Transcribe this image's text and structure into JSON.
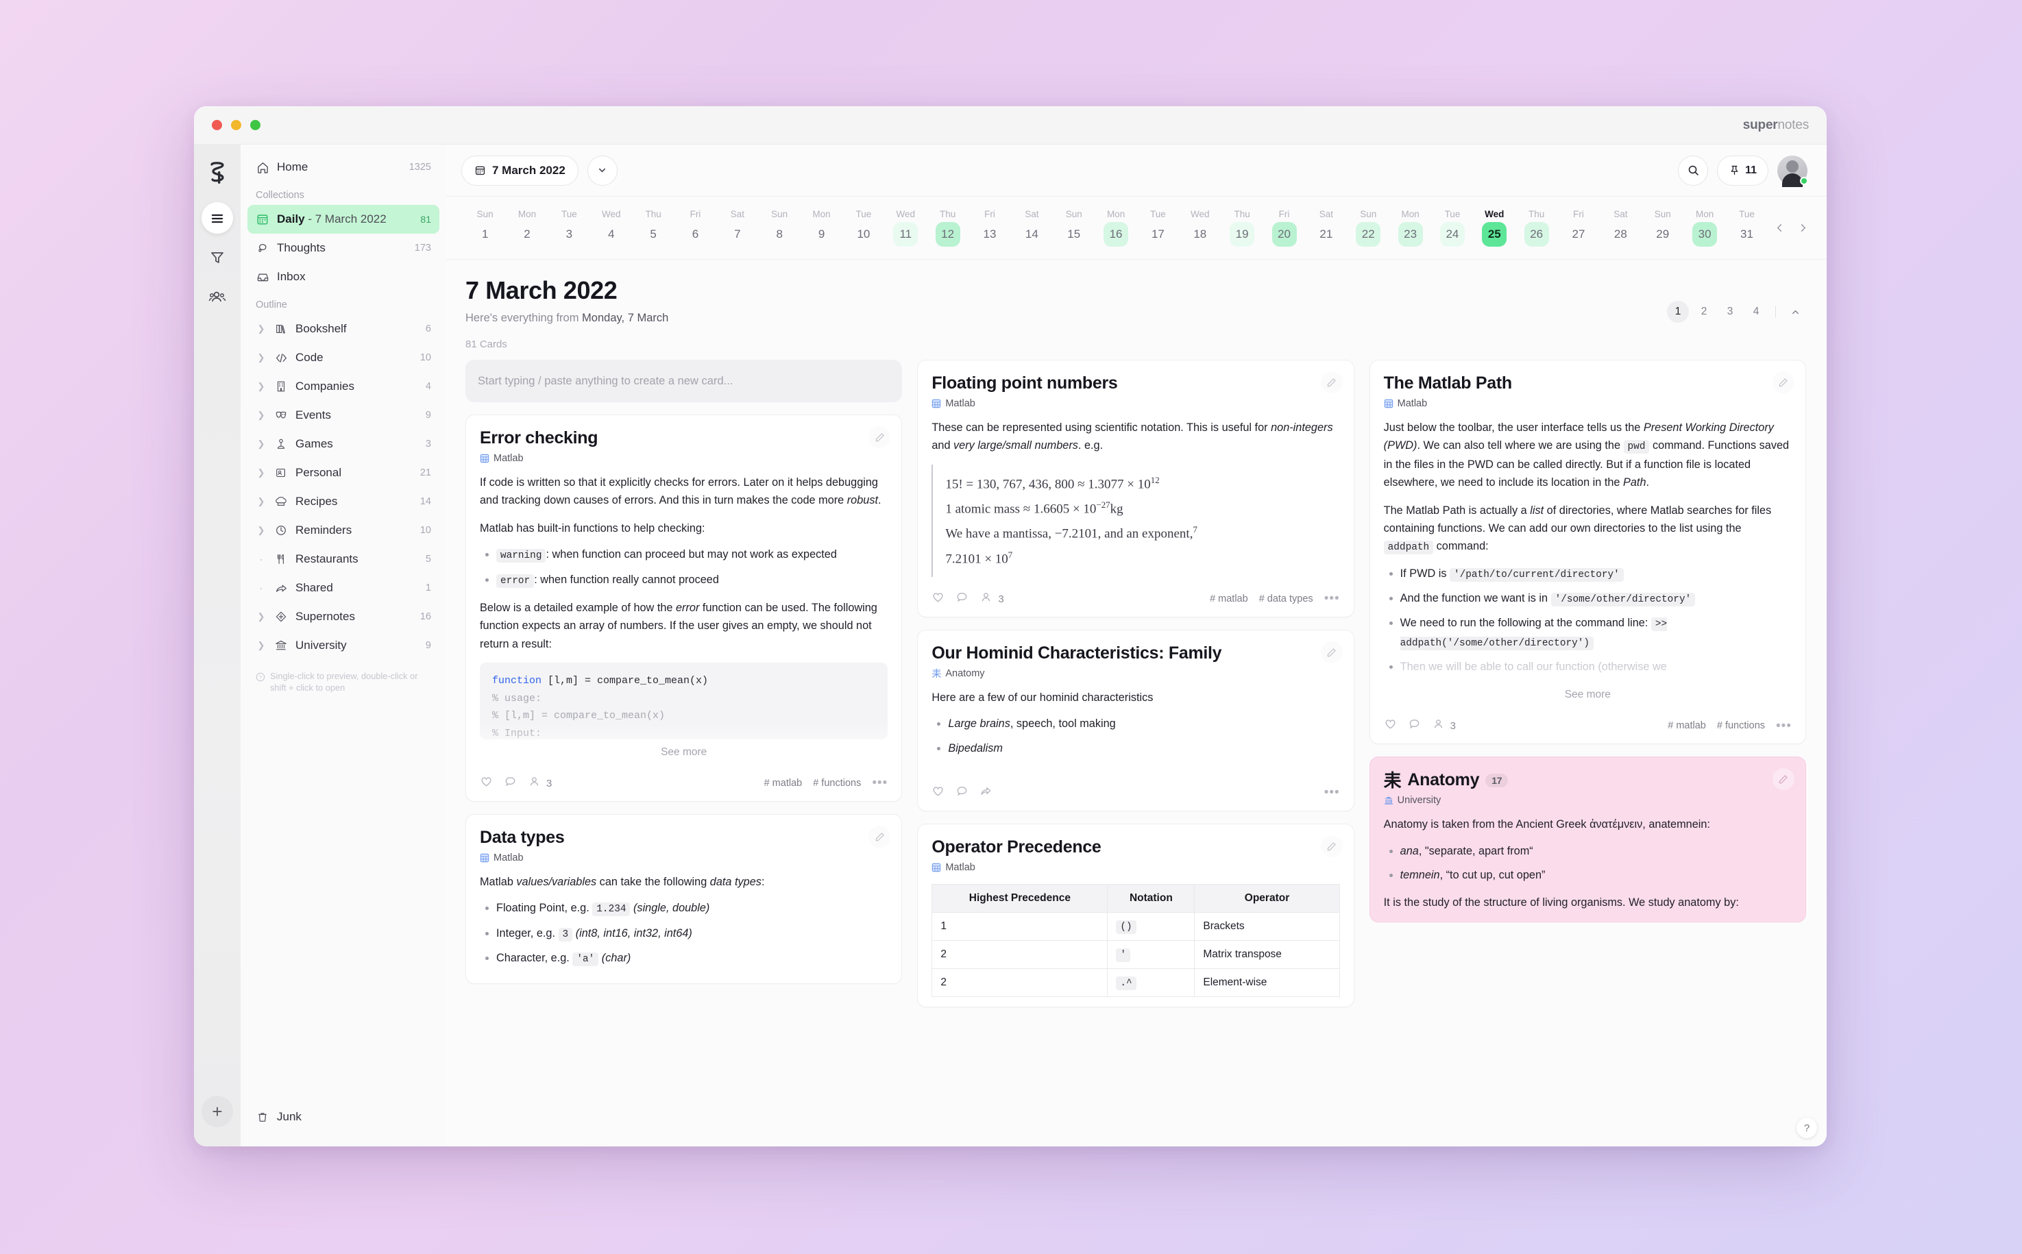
{
  "window": {
    "brand_bold": "super",
    "brand_light": "notes",
    "traffic": [
      "close",
      "minimize",
      "maximize"
    ]
  },
  "rail": {
    "logo": "supernotes-logo",
    "items": [
      {
        "name": "menu",
        "icon": "hamburger-icon",
        "active": true
      },
      {
        "name": "filter",
        "icon": "funnel-icon",
        "active": false
      },
      {
        "name": "people",
        "icon": "people-icon",
        "active": false
      }
    ],
    "add_label": "+"
  },
  "sidebar": {
    "home": {
      "label": "Home",
      "count": "1325",
      "icon": "home-icon"
    },
    "collections_title": "Collections",
    "collections": [
      {
        "label": "Daily",
        "suffix": " - 7 March 2022",
        "count": "81",
        "icon": "calendar-icon",
        "selected": true
      },
      {
        "label": "Thoughts",
        "suffix": "",
        "count": "173",
        "icon": "thought-bubble-icon",
        "selected": false
      },
      {
        "label": "Inbox",
        "suffix": "",
        "count": "",
        "icon": "inbox-icon",
        "selected": false
      }
    ],
    "outline_title": "Outline",
    "outline": [
      {
        "label": "Bookshelf",
        "count": "6",
        "icon": "books-icon",
        "caret": "chevron"
      },
      {
        "label": "Code",
        "count": "10",
        "icon": "code-icon",
        "caret": "chevron"
      },
      {
        "label": "Companies",
        "count": "4",
        "icon": "building-icon",
        "caret": "chevron"
      },
      {
        "label": "Events",
        "count": "9",
        "icon": "masks-icon",
        "caret": "chevron"
      },
      {
        "label": "Games",
        "count": "3",
        "icon": "joystick-icon",
        "caret": "chevron"
      },
      {
        "label": "Personal",
        "count": "21",
        "icon": "id-card-icon",
        "caret": "chevron"
      },
      {
        "label": "Recipes",
        "count": "14",
        "icon": "chef-hat-icon",
        "caret": "chevron"
      },
      {
        "label": "Reminders",
        "count": "10",
        "icon": "clock-icon",
        "caret": "chevron"
      },
      {
        "label": "Restaurants",
        "count": "5",
        "icon": "cutlery-icon",
        "caret": "dot"
      },
      {
        "label": "Shared",
        "count": "1",
        "icon": "share-arrow-icon",
        "caret": "dot"
      },
      {
        "label": "Supernotes",
        "count": "16",
        "icon": "diamond-icon",
        "caret": "chevron"
      },
      {
        "label": "University",
        "count": "9",
        "icon": "bank-icon",
        "caret": "chevron"
      }
    ],
    "hint": "Single-click to preview, double-click or shift + click to open",
    "junk": {
      "label": "Junk",
      "icon": "trash-icon"
    }
  },
  "topbar": {
    "date_pill": "7 March 2022",
    "date_pill_icon": "calendar-icon",
    "dropdown_icon": "chevron-down-icon",
    "search_icon": "search-icon",
    "pin_icon": "pin-icon",
    "pin_count": "11",
    "avatar": "user-avatar"
  },
  "calendar": {
    "prev_icon": "chevron-left-icon",
    "next_icon": "chevron-right-icon",
    "days": [
      {
        "dow": "Sun",
        "num": "1",
        "level": 0
      },
      {
        "dow": "Mon",
        "num": "2",
        "level": 0
      },
      {
        "dow": "Tue",
        "num": "3",
        "level": 0
      },
      {
        "dow": "Wed",
        "num": "4",
        "level": 0
      },
      {
        "dow": "Thu",
        "num": "5",
        "level": 0
      },
      {
        "dow": "Fri",
        "num": "6",
        "level": 0
      },
      {
        "dow": "Sat",
        "num": "7",
        "level": 0
      },
      {
        "dow": "Sun",
        "num": "8",
        "level": 0
      },
      {
        "dow": "Mon",
        "num": "9",
        "level": 0
      },
      {
        "dow": "Tue",
        "num": "10",
        "level": 0
      },
      {
        "dow": "Wed",
        "num": "11",
        "level": 1
      },
      {
        "dow": "Thu",
        "num": "12",
        "level": 3
      },
      {
        "dow": "Fri",
        "num": "13",
        "level": 0
      },
      {
        "dow": "Sat",
        "num": "14",
        "level": 0
      },
      {
        "dow": "Sun",
        "num": "15",
        "level": 0
      },
      {
        "dow": "Mon",
        "num": "16",
        "level": 2
      },
      {
        "dow": "Tue",
        "num": "17",
        "level": 0
      },
      {
        "dow": "Wed",
        "num": "18",
        "level": 0
      },
      {
        "dow": "Thu",
        "num": "19",
        "level": 1
      },
      {
        "dow": "Fri",
        "num": "20",
        "level": 3
      },
      {
        "dow": "Sat",
        "num": "21",
        "level": 0
      },
      {
        "dow": "Sun",
        "num": "22",
        "level": 2
      },
      {
        "dow": "Mon",
        "num": "23",
        "level": 2
      },
      {
        "dow": "Tue",
        "num": "24",
        "level": 1
      },
      {
        "dow": "Wed",
        "num": "25",
        "level": 4,
        "today": true
      },
      {
        "dow": "Thu",
        "num": "26",
        "level": 2
      },
      {
        "dow": "Fri",
        "num": "27",
        "level": 0
      },
      {
        "dow": "Sat",
        "num": "28",
        "level": 0
      },
      {
        "dow": "Sun",
        "num": "29",
        "level": 0
      },
      {
        "dow": "Mon",
        "num": "30",
        "level": 3
      },
      {
        "dow": "Tue",
        "num": "31",
        "level": 0
      }
    ]
  },
  "page": {
    "title": "7 March 2022",
    "sub_prefix": "Here's everything from ",
    "sub_strong": "Monday, 7 March",
    "card_count": "81 Cards",
    "pages": [
      "1",
      "2",
      "3",
      "4"
    ],
    "active_page": "1",
    "collapse_icon": "chevron-up-icon"
  },
  "composer": {
    "placeholder": "Start typing / paste anything to create a new card..."
  },
  "colors": {
    "accent_green": "#5ee698",
    "selected_green": "#c4f5d4",
    "pink_card": "#fbdceb",
    "code_blue": "#2f63e8"
  },
  "cards": {
    "error_checking": {
      "title": "Error checking",
      "source": "Matlab",
      "source_icon": "matlab-icon",
      "p1_a": "If code is written so that it explicitly checks for errors. Later on it helps debugging and tracking down causes of errors. And this in turn makes the code more ",
      "p1_em": "robust",
      "p1_b": ".",
      "p2": "Matlab has built-in functions to help checking:",
      "bullets": [
        {
          "code": "warning",
          "text": ": when function can proceed but may not work as expected"
        },
        {
          "code": "error",
          "text": ": when function really cannot proceed"
        }
      ],
      "p3_a": "Below is a detailed example of how the ",
      "p3_em": "error",
      "p3_b": " function can be used. The following function expects an array of numbers. If the user gives an empty, we should not return a result:",
      "code_kw": "function",
      "code_sig": " [l,m] = compare_to_mean(x)",
      "code_c1": "% usage:",
      "code_c2": "%     [l,m] = compare_to_mean(x)",
      "code_c3": "% Input:",
      "see_more": "See more",
      "footer": {
        "like_icon": "heart-icon",
        "comment_icon": "comment-icon",
        "people_icon": "people-icon",
        "people_count": "3",
        "tags": [
          "# matlab",
          "# functions"
        ],
        "more_icon": "more-icon"
      }
    },
    "data_types": {
      "title": "Data types",
      "source": "Matlab",
      "source_icon": "matlab-icon",
      "p1_a": "Matlab ",
      "p1_em1": "values/variables",
      "p1_b": " can take the following ",
      "p1_em2": "data types",
      "p1_c": ":",
      "bullets": [
        {
          "pre": "Floating Point, e.g. ",
          "code": "1.234",
          "post_em": " (single, double)"
        },
        {
          "pre": "Integer, e.g. ",
          "code": "3",
          "post_em": " (int8, int16, int32, int64)"
        },
        {
          "pre": "Character, e.g. ",
          "code": "'a'",
          "post_em": " (char)"
        }
      ]
    },
    "floating_point": {
      "title": "Floating point numbers",
      "source": "Matlab",
      "source_icon": "matlab-icon",
      "p1_a": "These can be represented using scientific notation. This is useful for ",
      "p1_em1": "non-integers",
      "p1_b": " and ",
      "p1_em2": "very large/small numbers",
      "p1_c": ". e.g.",
      "math": [
        "15! = 130, 767, 436, 800 ≈ 1.3077 × 10^12",
        "1 atomic mass ≈ 1.6605 × 10^−27 kg",
        "We have a mantissa, −7.2101, and an exponent, ^7",
        "7.2101 × 10^7"
      ],
      "footer": {
        "like_icon": "heart-icon",
        "comment_icon": "comment-icon",
        "people_icon": "people-icon",
        "people_count": "3",
        "tags": [
          "# matlab",
          "# data types"
        ],
        "more_icon": "more-icon"
      }
    },
    "hominid": {
      "title": "Our Hominid Characteristics: Family",
      "source": "Anatomy",
      "source_icon": "anatomy-icon",
      "p1": "Here are a few of our hominid characteristics",
      "bullets": [
        {
          "em": "Large brains",
          "rest": ", speech, tool making"
        },
        {
          "em": "Bipedalism",
          "rest": ""
        }
      ],
      "footer": {
        "like_icon": "heart-icon",
        "comment_icon": "comment-icon",
        "share_icon": "share-icon",
        "more_icon": "more-icon"
      }
    },
    "operator_precedence": {
      "title": "Operator Precedence",
      "source": "Matlab",
      "source_icon": "matlab-icon",
      "table": {
        "headers": [
          "Highest Precedence",
          "Notation",
          "Operator"
        ],
        "rows": [
          [
            "1",
            "()",
            "Brackets"
          ],
          [
            "2",
            "'",
            "Matrix transpose"
          ],
          [
            "2",
            ".^",
            "Element-wise"
          ]
        ]
      }
    },
    "matlab_path": {
      "title": "The Matlab Path",
      "source": "Matlab",
      "source_icon": "matlab-icon",
      "p1_a": "Just below the toolbar, the user interface tells us the ",
      "p1_em1": "Present Working Directory (PWD)",
      "p1_b": ". We can also tell where we are using the ",
      "p1_code1": "pwd",
      "p1_c": " command. Functions saved in the files in the PWD can be called directly. But if a function file is located elsewhere, we need to include its location in the ",
      "p1_em2": "Path",
      "p1_d": ".",
      "p2_a": "The Matlab Path is actually a ",
      "p2_em": "list",
      "p2_b": " of directories, where Matlab searches for files containing functions. We can add our own directories to the list using the ",
      "p2_code": "addpath",
      "p2_c": " command:",
      "bullets": [
        {
          "pre": "If PWD is ",
          "code": "'/path/to/current/directory'",
          "post": ""
        },
        {
          "pre": "And the function we want is in ",
          "code": "'/some/other/directory'",
          "post": ""
        },
        {
          "pre": "We need to run the following at the command line: ",
          "code": ">> addpath('/some/other/directory')",
          "post": ""
        },
        {
          "pre": "Then we will be able to call our function (otherwise we",
          "code": "",
          "post": ""
        }
      ],
      "see_more": "See more",
      "footer": {
        "like_icon": "heart-icon",
        "comment_icon": "comment-icon",
        "people_icon": "people-icon",
        "people_count": "3",
        "tags": [
          "# matlab",
          "# functions"
        ],
        "more_icon": "more-icon"
      }
    },
    "anatomy": {
      "title": "Anatomy",
      "badge": "17",
      "title_icon": "anatomy-icon",
      "source": "University",
      "source_icon": "bank-icon",
      "p1": "Anatomy is taken from the Ancient Greek ἀνατέμνειν, anatemnein:",
      "bullets": [
        {
          "em": "ana",
          "rest": ", \"separate, apart from“"
        },
        {
          "em": "temnein",
          "rest": ", “to cut up, cut open”"
        }
      ],
      "p2": "It is the study of the structure of living organisms. We study anatomy by:"
    }
  },
  "help_fab": "?"
}
